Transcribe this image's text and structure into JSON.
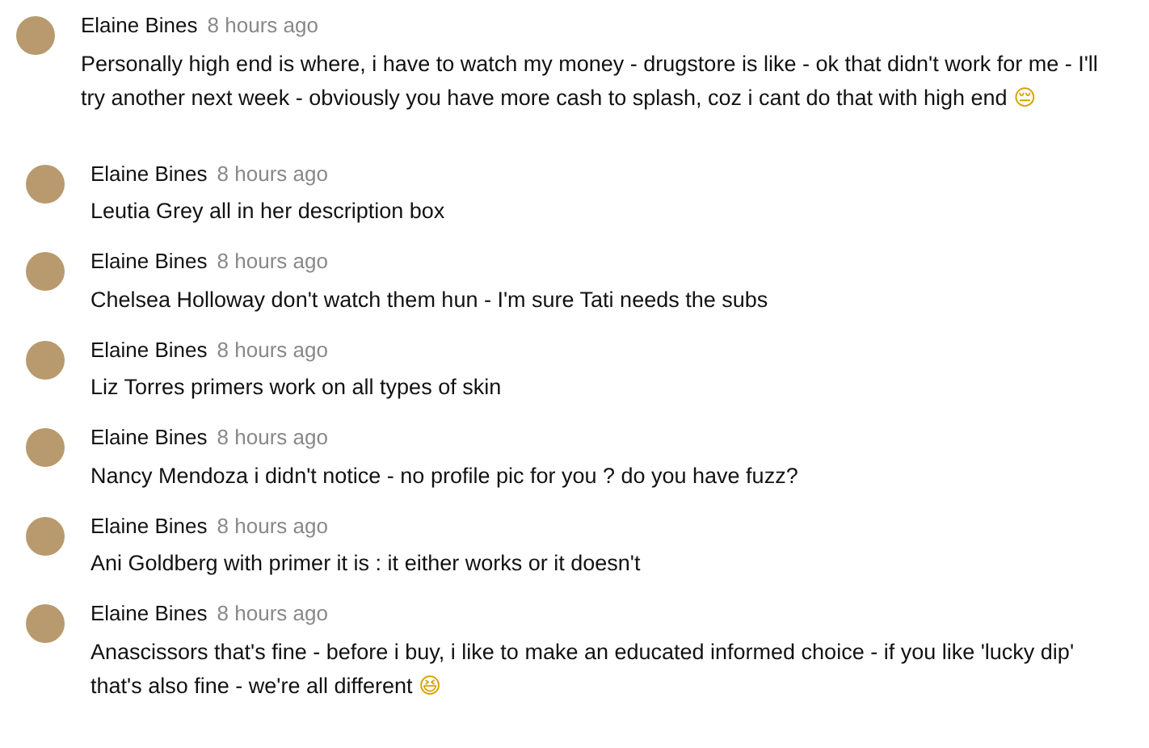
{
  "comment": {
    "author": "Elaine Bines",
    "time": "8 hours ago",
    "text": "Personally high end is where, i have to watch my money - drugstore is like - ok that didn't work for me - I'll try another next week - obviously you have more cash to splash, coz i cant do that with high end",
    "emoji": "😔"
  },
  "replies": [
    {
      "author": "Elaine Bines",
      "time": "8 hours ago",
      "text": "Leutia Grey all in her description box"
    },
    {
      "author": "Elaine Bines",
      "time": "8 hours ago",
      "text": "Chelsea Holloway don't watch them hun  - I'm sure Tati needs the subs"
    },
    {
      "author": "Elaine Bines",
      "time": "8 hours ago",
      "text": "Liz Torres primers work on all types of skin"
    },
    {
      "author": "Elaine Bines",
      "time": "8 hours ago",
      "text": "Nancy Mendoza i didn't notice - no profile pic for you ? do you have fuzz?"
    },
    {
      "author": "Elaine Bines",
      "time": "8 hours ago",
      "text": "Ani Goldberg with primer it is : it either works or it doesn't"
    },
    {
      "author": "Elaine Bines",
      "time": "8 hours ago",
      "text": "Anascissors that's fine - before i buy, i like to make an educated informed choice - if you like 'lucky dip' that's also fine - we're all different",
      "emoji": "😆"
    }
  ]
}
